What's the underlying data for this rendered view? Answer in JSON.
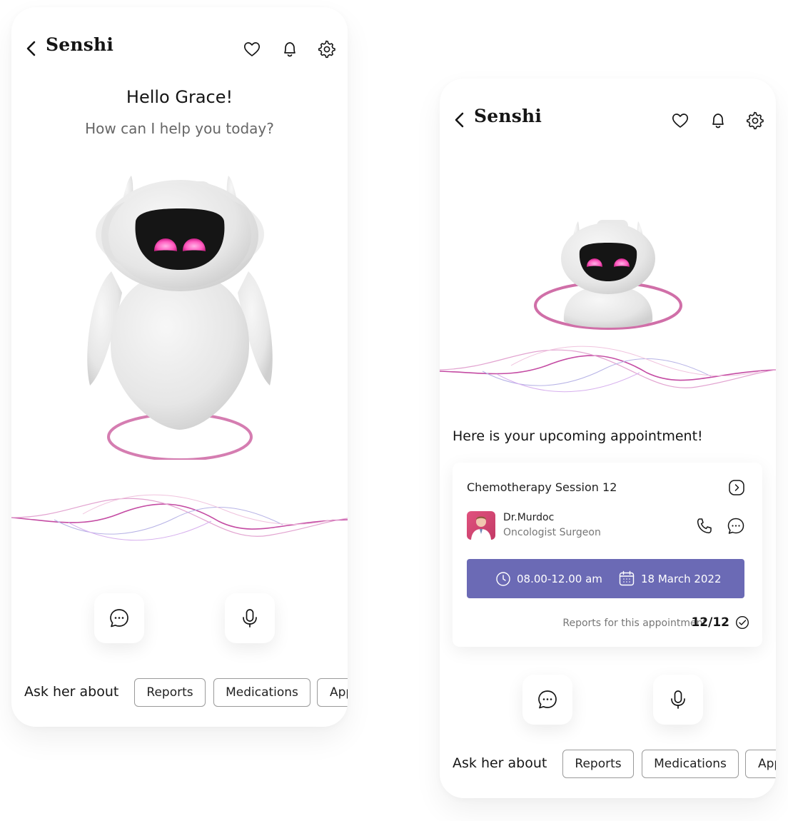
{
  "screens": {
    "home": {
      "app_title": "Senshi",
      "greeting": "Hello Grace!",
      "subgreeting": "How can I help you today?",
      "ask_label": "Ask her about",
      "chips": [
        "Reports",
        "Medications",
        "Appointments"
      ]
    },
    "appointment": {
      "app_title": "Senshi",
      "heading": "Here is your upcoming appointment!",
      "card": {
        "title": "Chemotherapy Session 12",
        "doctor_name": "Dr.Murdoc",
        "doctor_role": "Oncologist Surgeon",
        "time": "08.00-12.00 am",
        "date": "18 March 2022",
        "reports_label": "Reports for this appointment",
        "reports_count": "12/12"
      },
      "ask_label": "Ask her about",
      "chips": [
        "Reports",
        "Medications",
        "Appointments"
      ]
    }
  },
  "icons": [
    "back-icon",
    "heart-icon",
    "bell-icon",
    "gear-icon",
    "chat-icon",
    "mic-icon",
    "arrow-right-icon",
    "phone-icon",
    "message-icon",
    "clock-icon",
    "calendar-icon",
    "check-icon"
  ],
  "colors": {
    "accent_pink": "#d06fa8",
    "time_bar": "#6b6ab5",
    "robot_eye": "#ff5dc0",
    "text_primary": "#151515",
    "text_secondary": "#777777"
  }
}
